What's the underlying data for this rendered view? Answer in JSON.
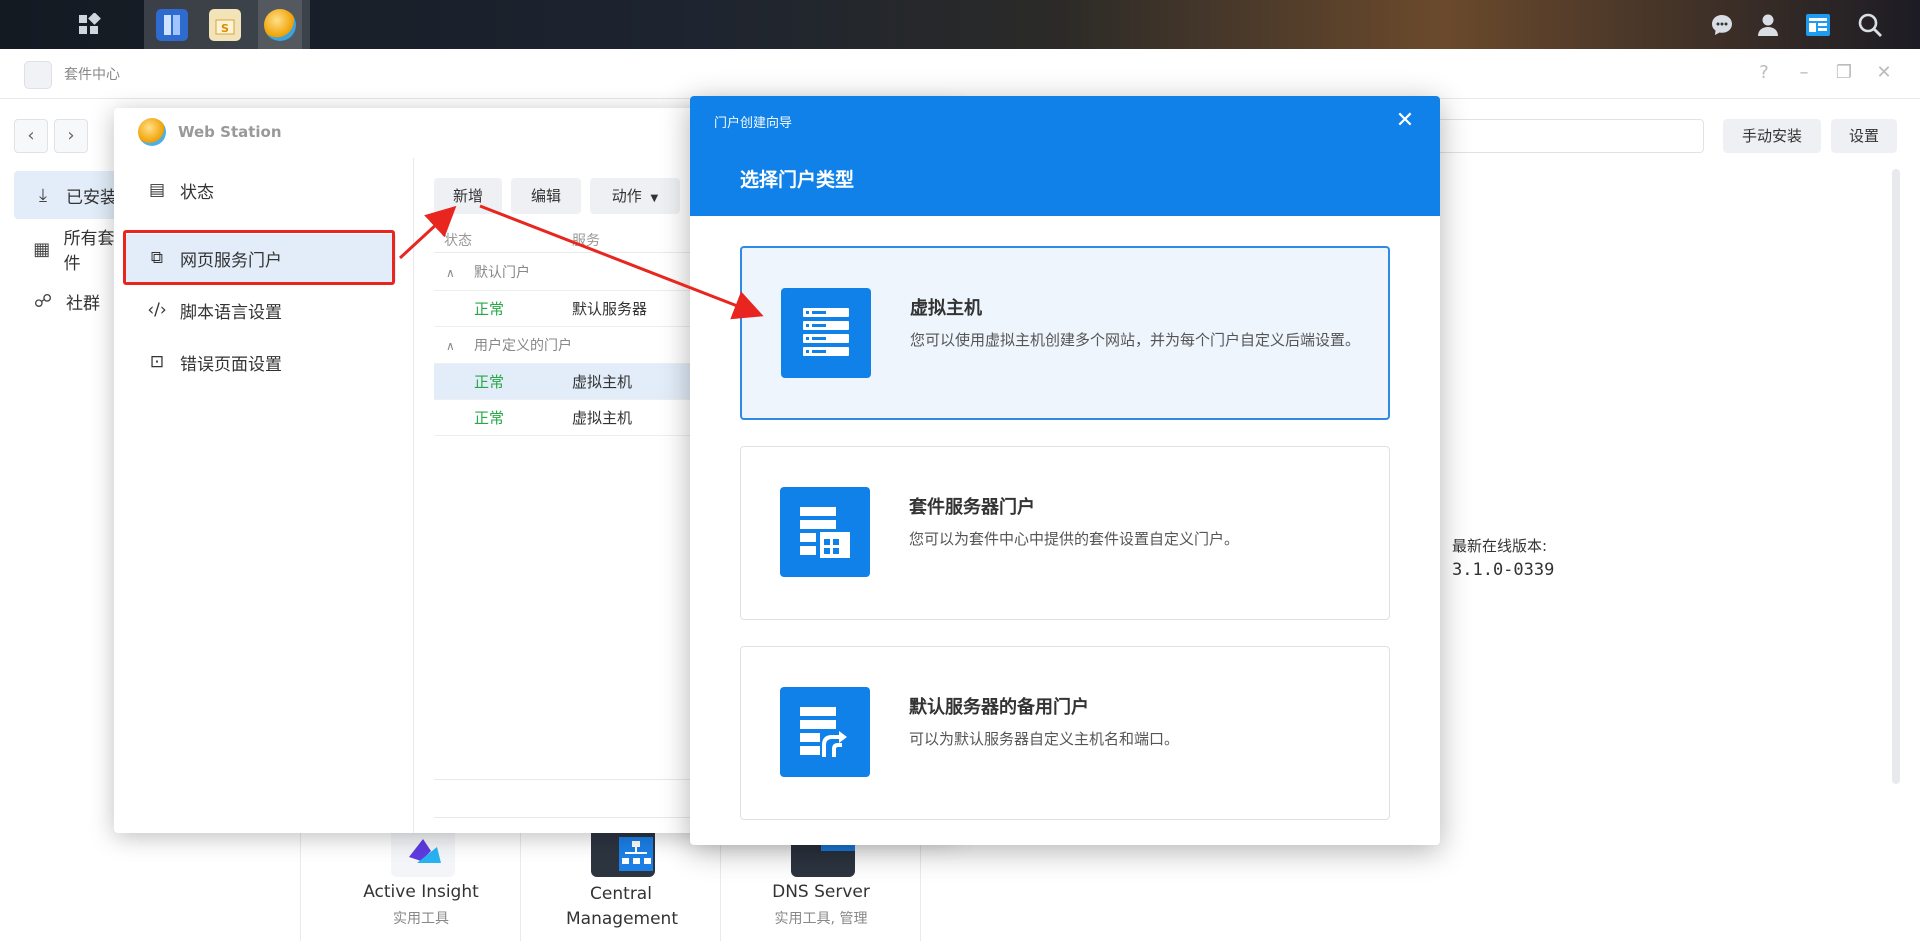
{
  "package_center": {
    "title": "套件中心",
    "buttons": {
      "manual_install": "手动安装",
      "settings": "设置"
    },
    "sidebar": [
      {
        "label": "已安装",
        "icon": "download-icon"
      },
      {
        "label": "所有套件",
        "icon": "grid-icon"
      },
      {
        "label": "社群",
        "icon": "community-icon"
      }
    ],
    "latest_version_label": "最新在线版本:",
    "latest_version": "3.1.0-0339",
    "tiles": [
      {
        "name": "Active Insight",
        "category": "实用工具"
      },
      {
        "name": "Central Management",
        "category": ""
      },
      {
        "name": "DNS Server",
        "category": "实用工具, 管理"
      }
    ]
  },
  "web_station": {
    "title": "Web Station",
    "sidebar": [
      {
        "label": "状态",
        "icon": "status-icon"
      },
      {
        "label": "网页服务门户",
        "icon": "portal-icon"
      },
      {
        "label": "脚本语言设置",
        "icon": "code-icon"
      },
      {
        "label": "错误页面设置",
        "icon": "error-page-icon"
      }
    ],
    "toolbar": {
      "add": "新增",
      "edit": "编辑",
      "action": "动作"
    },
    "columns": {
      "status": "状态",
      "service": "服务"
    },
    "groups": {
      "default": "默认门户",
      "user": "用户定义的门户"
    },
    "rows_default": [
      {
        "status": "正常",
        "service": "默认服务器"
      }
    ],
    "rows_user": [
      {
        "status": "正常",
        "service": "虚拟主机"
      },
      {
        "status": "正常",
        "service": "虚拟主机"
      }
    ]
  },
  "wizard": {
    "window_title": "门户创建向导",
    "heading": "选择门户类型",
    "options": [
      {
        "title": "虚拟主机",
        "desc": "您可以使用虚拟主机创建多个网站，并为每个门户自定义后端设置。",
        "icon": "server-stack-icon"
      },
      {
        "title": "套件服务器门户",
        "desc": "您可以为套件中心中提供的套件设置自定义门户。",
        "icon": "package-server-icon"
      },
      {
        "title": "默认服务器的备用门户",
        "desc": "可以为默认服务器自定义主机名和端口。",
        "icon": "alias-server-icon"
      }
    ]
  },
  "colors": {
    "accent": "#1081e8",
    "annotation": "#e8261f",
    "ok": "#27a844"
  }
}
